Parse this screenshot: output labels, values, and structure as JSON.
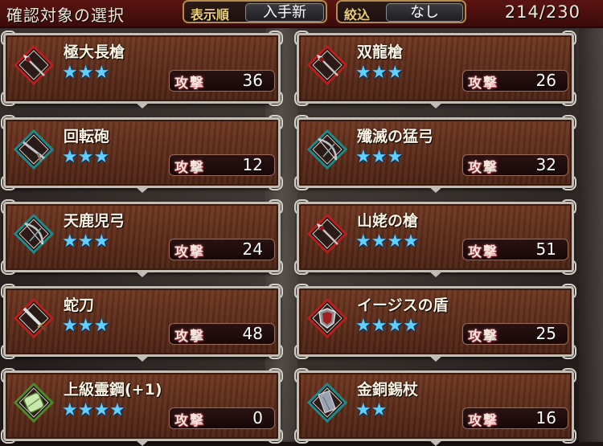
{
  "header": {
    "title": "確認対象の選択",
    "sort_label": "表示順",
    "sort_value": "入手新",
    "filter_label": "絞込",
    "filter_value": "なし",
    "count": "214/230"
  },
  "atk_label": "攻撃",
  "colors": {
    "header_bg": "#4a0f0e",
    "card_bg": "#5a2a18",
    "star": "#5fd0ff",
    "label_gold": "#f0d070"
  },
  "items": [
    {
      "name": "極大長槍",
      "stars": "★★★",
      "attack": "36",
      "icon": "spear-icon",
      "frame": "red"
    },
    {
      "name": "双龍槍",
      "stars": "★★★",
      "attack": "26",
      "icon": "spear-icon",
      "frame": "red"
    },
    {
      "name": "回転砲",
      "stars": "★★★",
      "attack": "12",
      "icon": "gun-icon",
      "frame": "teal"
    },
    {
      "name": "殲滅の猛弓",
      "stars": "★★★",
      "attack": "32",
      "icon": "bow-icon",
      "frame": "teal"
    },
    {
      "name": "天鹿児弓",
      "stars": "★★★",
      "attack": "24",
      "icon": "bow-icon",
      "frame": "teal"
    },
    {
      "name": "山姥の槍",
      "stars": "★★★★",
      "attack": "51",
      "icon": "spear-icon",
      "frame": "red"
    },
    {
      "name": "蛇刀",
      "stars": "★★★",
      "attack": "48",
      "icon": "sword-icon",
      "frame": "red"
    },
    {
      "name": "イージスの盾",
      "stars": "★★★★",
      "attack": "25",
      "icon": "shield-icon",
      "frame": "red"
    },
    {
      "name": "上級霊鋼(+1)",
      "stars": "★★★★",
      "attack": "0",
      "icon": "ore-icon",
      "frame": "green"
    },
    {
      "name": "金銅錫杖",
      "stars": "★★",
      "attack": "16",
      "icon": "staff-icon",
      "frame": "teal"
    }
  ]
}
